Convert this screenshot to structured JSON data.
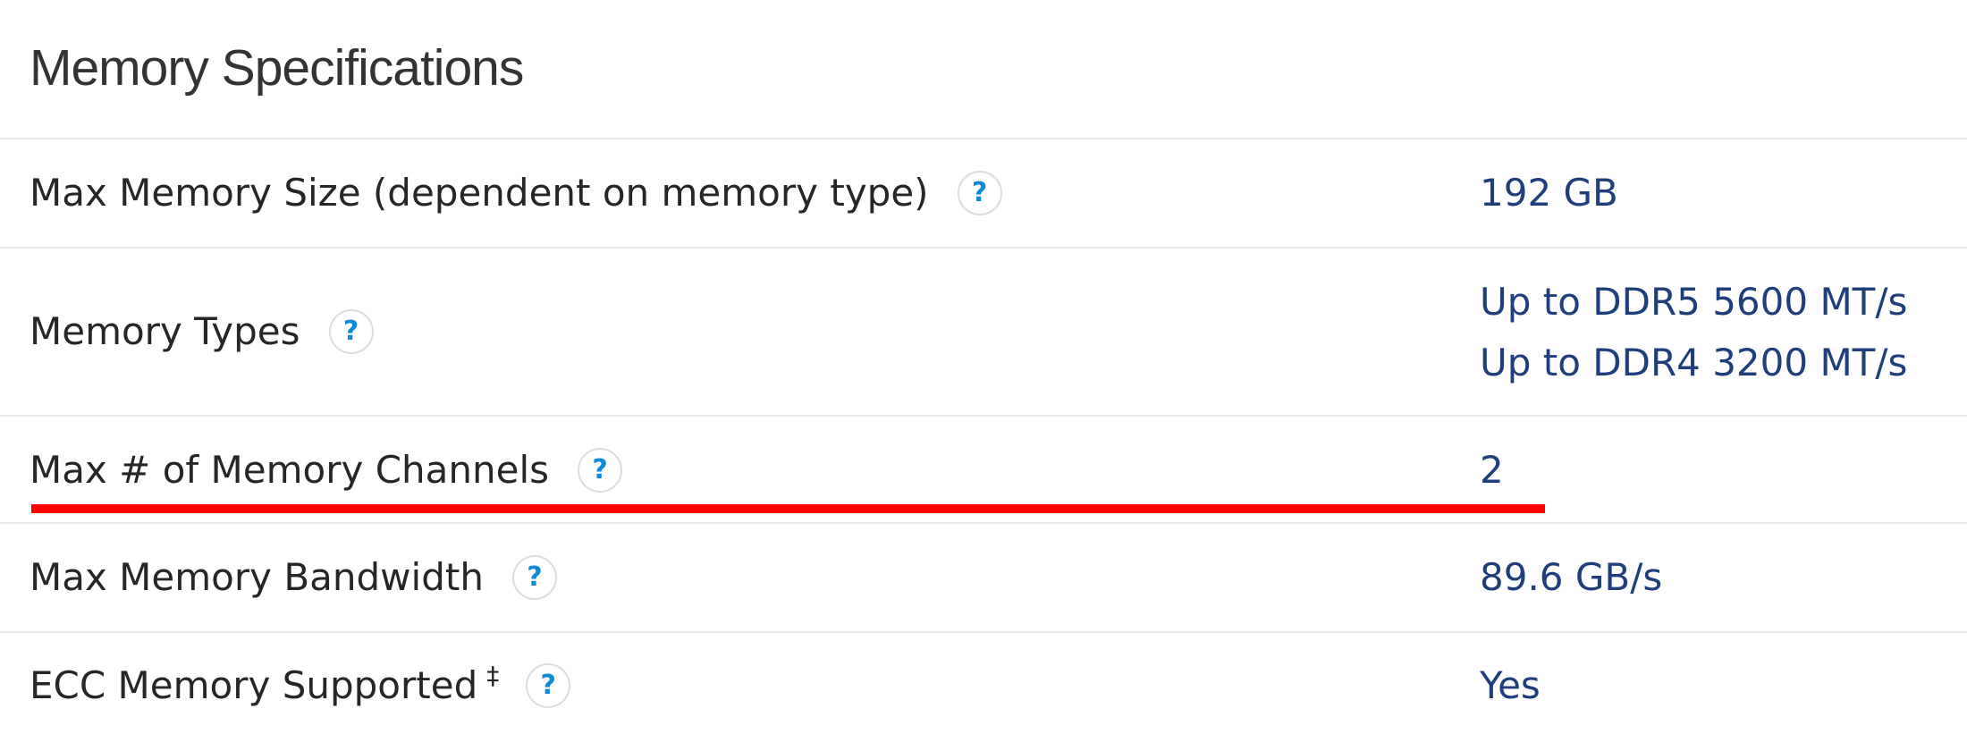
{
  "section": {
    "title": "Memory Specifications"
  },
  "specs": [
    {
      "label": "Max Memory Size (dependent on memory type)",
      "help_icon": "?",
      "values": [
        "192 GB"
      ]
    },
    {
      "label": "Memory Types",
      "help_icon": "?",
      "values": [
        "Up to DDR5 5600 MT/s",
        "Up to DDR4 3200 MT/s"
      ]
    },
    {
      "label": "Max # of Memory Channels",
      "help_icon": "?",
      "values": [
        "2"
      ],
      "highlighted": true
    },
    {
      "label": "Max Memory Bandwidth",
      "help_icon": "?",
      "values": [
        "89.6 GB/s"
      ]
    },
    {
      "label": "ECC Memory Supported",
      "footnote_mark": "‡",
      "help_icon": "?",
      "values": [
        "Yes"
      ]
    }
  ],
  "colors": {
    "value_text": "#1e3f7c",
    "help_icon": "#0d8ad8",
    "divider": "#e8e8e8",
    "highlight": "#ff0000"
  }
}
